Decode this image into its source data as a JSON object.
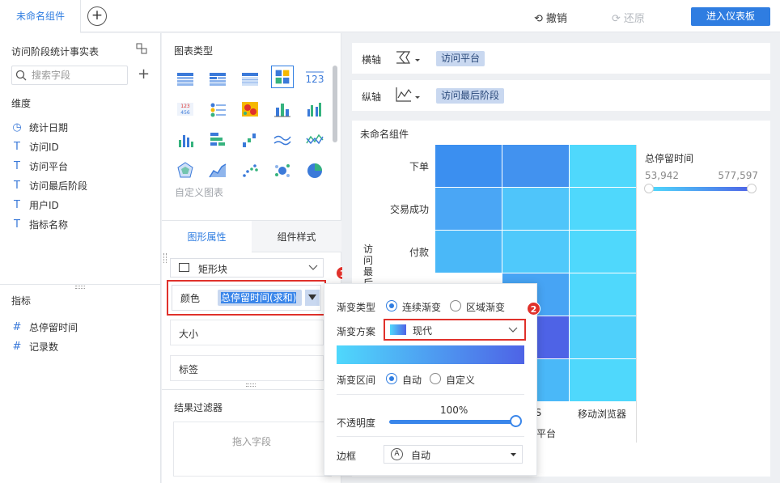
{
  "topbar": {
    "tab_label": "未命名组件",
    "undo_label": "撤销",
    "redo_label": "还原",
    "enter_dashboard_label": "进入仪表板"
  },
  "left": {
    "dataset_title": "访问阶段统计事实表",
    "search_placeholder": "搜索字段",
    "dimension_heading": "维度",
    "dimensions": [
      {
        "icon": "clock-icon",
        "label": "统计日期"
      },
      {
        "icon": "text-icon",
        "label": "访问ID"
      },
      {
        "icon": "text-icon",
        "label": "访问平台"
      },
      {
        "icon": "text-icon",
        "label": "访问最后阶段"
      },
      {
        "icon": "text-icon",
        "label": "用户ID"
      },
      {
        "icon": "text-icon",
        "label": "指标名称"
      }
    ],
    "measure_heading": "指标",
    "measures": [
      {
        "icon": "hash-icon",
        "label": "总停留时间"
      },
      {
        "icon": "hash-icon",
        "label": "记录数"
      }
    ]
  },
  "middle": {
    "chart_type_heading": "图表类型",
    "custom_chart_label": "自定义图表",
    "tab_graphic": "图形属性",
    "tab_component_style": "组件样式",
    "shape_value": "矩形块",
    "color_label": "颜色",
    "color_field": "总停留时间(求和)",
    "size_label": "大小",
    "tag_label": "标签",
    "filter_heading": "结果过滤器",
    "drop_field_hint": "拖入字段",
    "badge_1": "1",
    "badge_2": "2"
  },
  "right": {
    "x_axis_label": "横轴",
    "x_axis_field": "访问平台",
    "y_axis_label": "纵轴",
    "y_axis_field": "访问最后阶段",
    "component_title": "未命名组件",
    "y_categories": [
      "下单",
      "交易成功",
      "付款"
    ],
    "y_axis_title_partial": "访问最后阶",
    "x_categories_visible": [
      "OS",
      "移动浏览器"
    ],
    "x_axis_title_partial": "平台",
    "legend_title": "总停留时间",
    "legend_min": "53,942",
    "legend_max": "577,597",
    "colors": {
      "cell_dark": "#3b8ff0",
      "cell_mid": "#4aa6f5",
      "cell_light": "#4fd8fc",
      "cell_deep": "#4e63e6"
    }
  },
  "popup": {
    "gradient_type_label": "渐变类型",
    "continuous_label": "连续渐变",
    "region_label": "区域渐变",
    "scheme_label": "渐变方案",
    "scheme_value": "现代",
    "range_label": "渐变区间",
    "auto_label": "自动",
    "custom_label": "自定义",
    "opacity_label": "不透明度",
    "opacity_value": "100%",
    "border_label": "边框",
    "border_value": "自动"
  }
}
